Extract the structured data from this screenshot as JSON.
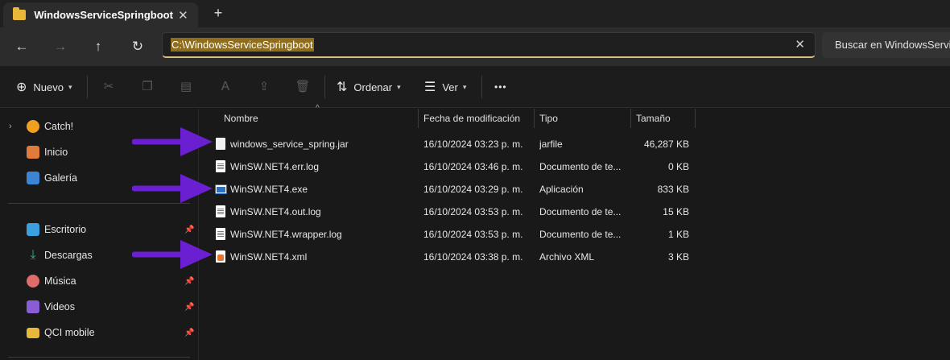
{
  "tab": {
    "title": "WindowsServiceSpringboot",
    "close": "✕",
    "new_tab": "+"
  },
  "nav": {
    "back": "←",
    "forward": "→",
    "up": "↑",
    "refresh": "↻"
  },
  "address": {
    "path": "C:\\WindowsServiceSpringboot",
    "clear": "✕"
  },
  "search": {
    "placeholder": "Buscar en WindowsService"
  },
  "toolbar": {
    "new_label": "Nuevo",
    "sort_label": "Ordenar",
    "view_label": "Ver",
    "more": "•••"
  },
  "sidebar": {
    "items": [
      {
        "label": "Catch!",
        "icon": "lightning-icon",
        "color": "#f0a020"
      },
      {
        "label": "Inicio",
        "icon": "home-icon",
        "color": "#e07b39"
      },
      {
        "label": "Galería",
        "icon": "gallery-icon",
        "color": "#3a86d4"
      }
    ],
    "pinned": [
      {
        "label": "Escritorio",
        "icon": "desktop-icon",
        "color": "#3aa0e0"
      },
      {
        "label": "Descargas",
        "icon": "download-icon",
        "color": "#2fb57a"
      },
      {
        "label": "Música",
        "icon": "music-icon",
        "color": "#e06b6b"
      },
      {
        "label": "Videos",
        "icon": "video-icon",
        "color": "#8a5cd6"
      },
      {
        "label": "QCI mobile",
        "icon": "folder-icon",
        "color": "#e8b83a"
      }
    ]
  },
  "columns": {
    "name": "Nombre",
    "modified": "Fecha de modificación",
    "type": "Tipo",
    "size": "Tamaño"
  },
  "files": [
    {
      "name": "windows_service_spring.jar",
      "modified": "16/10/2024 03:23 p. m.",
      "type": "jarfile",
      "size": "46,287 KB",
      "icon": "jar-file-icon"
    },
    {
      "name": "WinSW.NET4.err.log",
      "modified": "16/10/2024 03:46 p. m.",
      "type": "Documento de te...",
      "size": "0 KB",
      "icon": "text-file-icon"
    },
    {
      "name": "WinSW.NET4.exe",
      "modified": "16/10/2024 03:29 p. m.",
      "type": "Aplicación",
      "size": "833 KB",
      "icon": "application-icon"
    },
    {
      "name": "WinSW.NET4.out.log",
      "modified": "16/10/2024 03:53 p. m.",
      "type": "Documento de te...",
      "size": "15 KB",
      "icon": "text-file-icon"
    },
    {
      "name": "WinSW.NET4.wrapper.log",
      "modified": "16/10/2024 03:53 p. m.",
      "type": "Documento de te...",
      "size": "1 KB",
      "icon": "text-file-icon"
    },
    {
      "name": "WinSW.NET4.xml",
      "modified": "16/10/2024 03:38 p. m.",
      "type": "Archivo XML",
      "size": "3 KB",
      "icon": "xml-file-icon"
    }
  ],
  "annotation_color": "#6a1fd0"
}
